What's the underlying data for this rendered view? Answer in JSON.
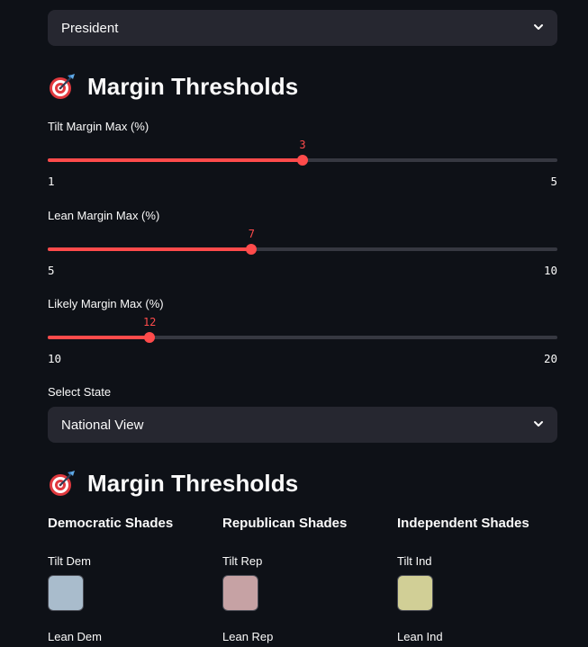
{
  "office_select": {
    "value": "President"
  },
  "section1": {
    "title": "Margin Thresholds",
    "icon": "target-dart-icon"
  },
  "sliders": [
    {
      "label": "Tilt Margin Max (%)",
      "value": 3,
      "min": 1,
      "max": 5
    },
    {
      "label": "Lean Margin Max (%)",
      "value": 7,
      "min": 5,
      "max": 10
    },
    {
      "label": "Likely Margin Max (%)",
      "value": 12,
      "min": 10,
      "max": 20
    }
  ],
  "state_select": {
    "label": "Select State",
    "value": "National View"
  },
  "section2": {
    "title": "Margin Thresholds",
    "icon": "target-dart-icon"
  },
  "shades": {
    "democratic": {
      "heading": "Democratic Shades",
      "tilt_label": "Tilt Dem",
      "tilt_color": "#a9bccc",
      "lean_label": "Lean Dem"
    },
    "republican": {
      "heading": "Republican Shades",
      "tilt_label": "Tilt Rep",
      "tilt_color": "#c6a2a4",
      "lean_label": "Lean Rep"
    },
    "independent": {
      "heading": "Independent Shades",
      "tilt_label": "Tilt Ind",
      "tilt_color": "#d1cf96",
      "lean_label": "Lean Ind"
    }
  },
  "colors": {
    "accent": "#ff4b4b",
    "background": "#0e1117",
    "widget": "#262730"
  }
}
